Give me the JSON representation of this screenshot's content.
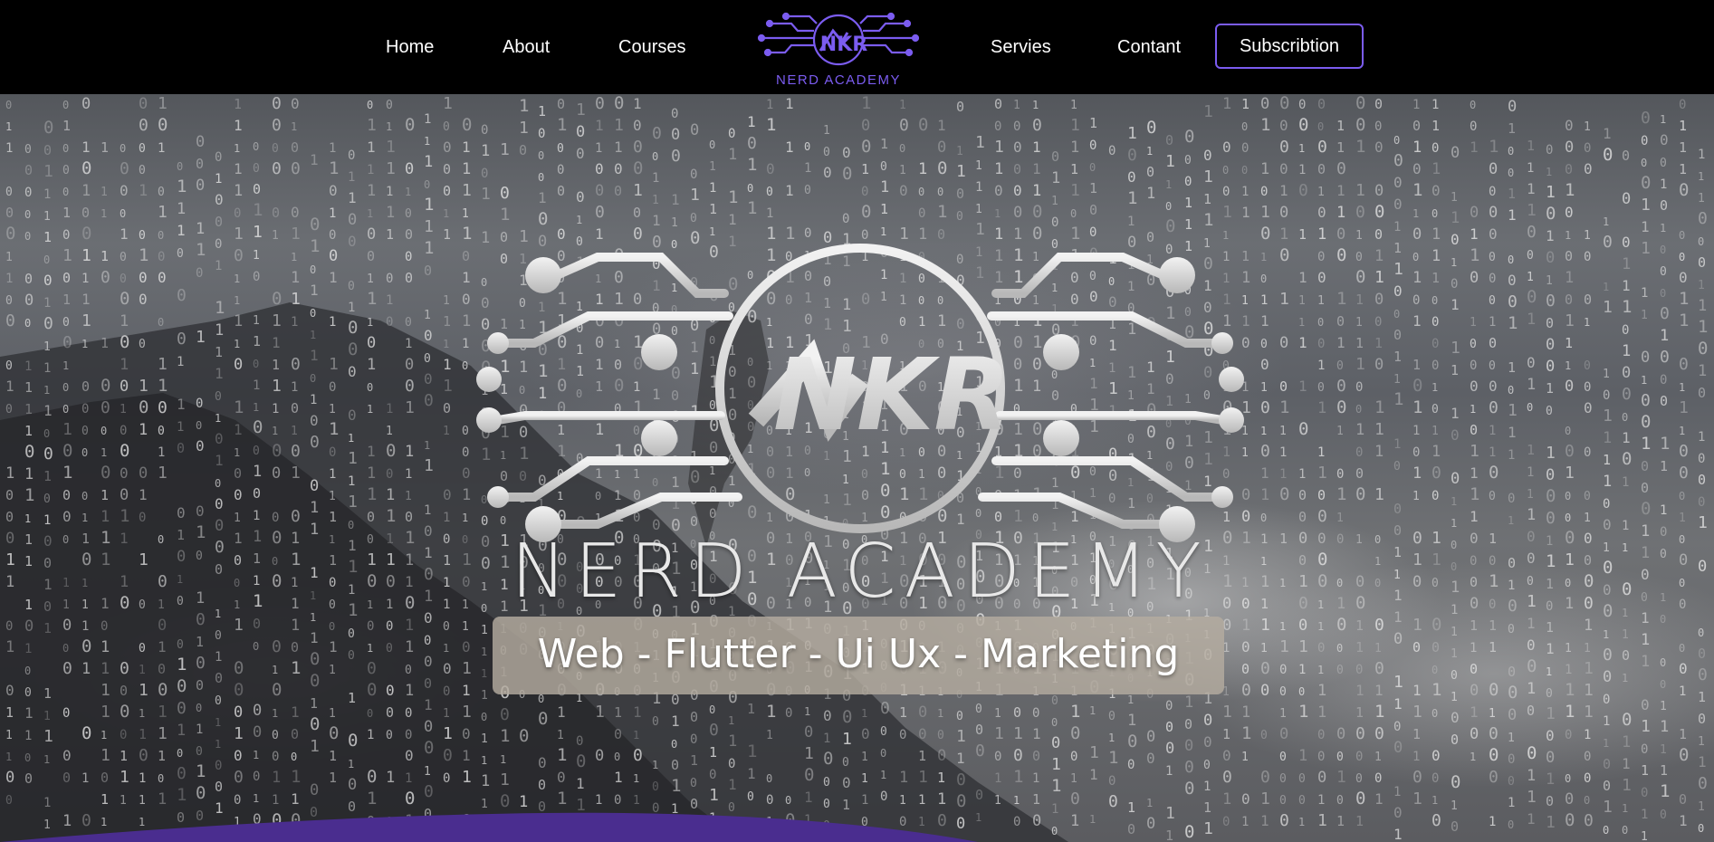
{
  "nav": {
    "links": [
      "Home",
      "About",
      "Courses",
      "Servies",
      "Contant"
    ],
    "subscribe_label": "Subscribtion",
    "logo_text": "NERD ACADEMY",
    "logo_mark": "NKR"
  },
  "hero": {
    "title": "NERD ACADEMY",
    "tagline": "Web - Flutter - Ui Ux - Marketing",
    "logo_mark": "NKR"
  },
  "colors": {
    "accent": "#7b5cf0",
    "wave": "#4a2d8f",
    "nav_bg": "#000000"
  },
  "icons": [
    "circuit-logo-icon"
  ]
}
